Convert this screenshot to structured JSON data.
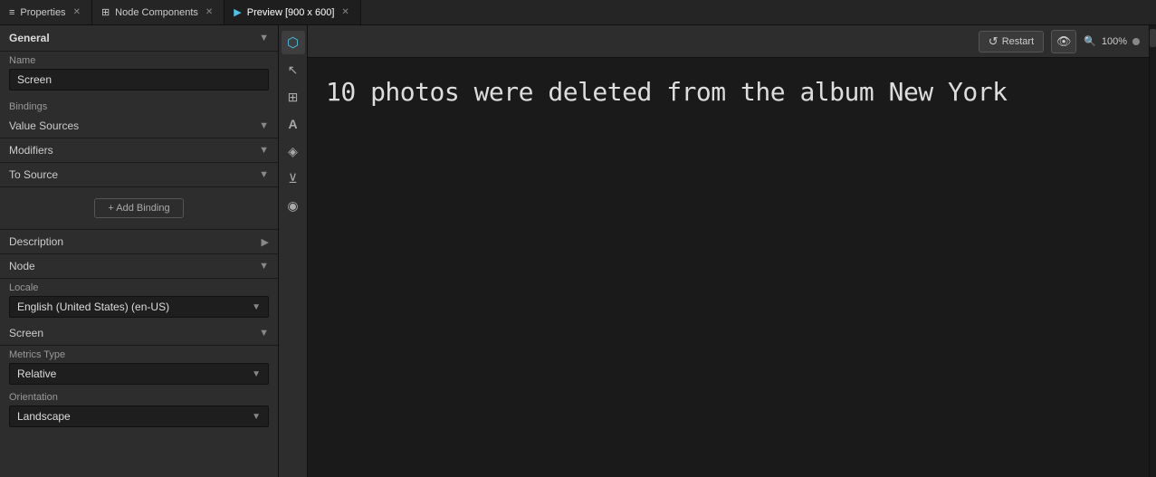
{
  "tabs": [
    {
      "id": "properties",
      "label": "Properties",
      "icon": "≡",
      "active": false,
      "closable": true
    },
    {
      "id": "node-components",
      "label": "Node Components",
      "icon": "⊞",
      "active": false,
      "closable": true
    },
    {
      "id": "preview",
      "label": "Preview [900 x 600]",
      "icon": "▶",
      "active": true,
      "closable": true
    }
  ],
  "toolbar": {
    "tools": [
      {
        "id": "cursor",
        "icon": "↖",
        "active": false,
        "label": "cursor-tool"
      },
      {
        "id": "pointer",
        "icon": "↗",
        "active": false,
        "label": "pointer-tool"
      },
      {
        "id": "grid",
        "icon": "⊞",
        "active": false,
        "label": "grid-tool"
      },
      {
        "id": "text",
        "icon": "A",
        "active": false,
        "label": "text-tool"
      },
      {
        "id": "layers",
        "icon": "◈",
        "active": false,
        "label": "layers-tool"
      },
      {
        "id": "share",
        "icon": "⊻",
        "active": false,
        "label": "share-tool"
      },
      {
        "id": "camera",
        "icon": "⬡",
        "active": false,
        "label": "camera-tool"
      }
    ]
  },
  "preview": {
    "title": "Preview [900 x 600]",
    "restart_label": "Restart",
    "zoom_label": "100%",
    "content_text": "10 photos were deleted from the album New York"
  },
  "properties_panel": {
    "general_section": {
      "title": "General",
      "name_label": "Name",
      "name_value": "Screen"
    },
    "bindings_section": {
      "title": "Bindings",
      "value_sources_label": "Value Sources",
      "modifiers_label": "Modifiers",
      "to_source_label": "To Source",
      "add_binding_label": "+ Add Binding"
    },
    "description_section": {
      "title": "Description",
      "expanded": false
    },
    "node_section": {
      "title": "Node",
      "expanded": false
    },
    "locale_section": {
      "label": "Locale",
      "value": "English (United States) (en-US)"
    },
    "screen_section": {
      "title": "Screen",
      "expanded": false
    },
    "metrics_type_section": {
      "label": "Metrics Type",
      "value": "Relative"
    },
    "orientation_section": {
      "label": "Orientation",
      "value": "Landscape"
    }
  },
  "colors": {
    "accent": "#4fc1e9",
    "bg_dark": "#1e1e1e",
    "bg_panel": "#2d2d2d",
    "border": "#111"
  }
}
